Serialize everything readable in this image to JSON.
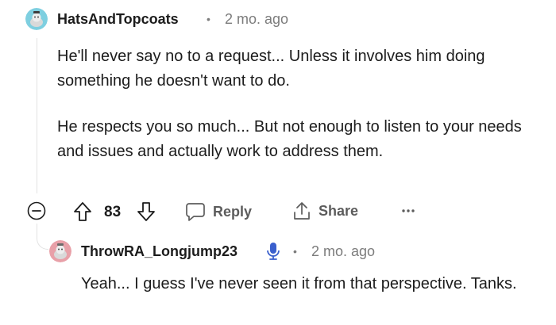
{
  "comment": {
    "username": "HatsAndTopcoats",
    "separator": "•",
    "timestamp": "2 mo. ago",
    "paragraphs": [
      "He'll never say no to a request... Unless it involves him doing something he doesn't want to do.",
      "He respects you so much... But not enough to listen to your needs and issues and actually work to address them."
    ],
    "vote_count": "83",
    "reply_label": "Reply",
    "share_label": "Share",
    "avatar_color": "#7ecfe0"
  },
  "reply": {
    "username": "ThrowRA_Longjump23",
    "separator": "•",
    "timestamp": "2 mo. ago",
    "text": "Yeah... I guess I've never seen it from that perspective. Tanks.",
    "avatar_color": "#e8a0a8",
    "badge_icon": "microphone-icon",
    "badge_color": "#3a5fcd"
  },
  "icons": {
    "collapse": "minus-circle-icon",
    "upvote": "arrow-up-icon",
    "downvote": "arrow-down-icon",
    "reply": "speech-bubble-icon",
    "share": "share-icon",
    "more": "ellipsis-icon"
  }
}
